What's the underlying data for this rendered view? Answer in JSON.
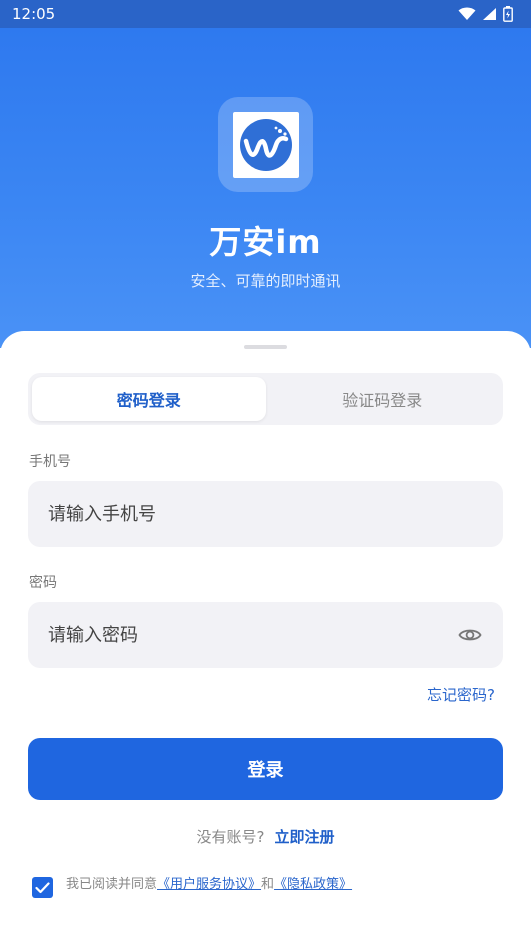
{
  "status_bar": {
    "time": "12:05",
    "icons": [
      "wifi-icon",
      "signal-icon",
      "battery-icon"
    ]
  },
  "app": {
    "title": "万安im",
    "subtitle": "安全、可靠的即时通讯",
    "icon": "app-logo-icon"
  },
  "tabs": [
    {
      "label": "密码登录",
      "active": true
    },
    {
      "label": "验证码登录",
      "active": false
    }
  ],
  "phone": {
    "label": "手机号",
    "placeholder": "请输入手机号",
    "value": ""
  },
  "password": {
    "label": "密码",
    "placeholder": "请输入密码",
    "value": "",
    "toggle_icon": "eye-icon"
  },
  "forgot_label": "忘记密码?",
  "login_label": "登录",
  "register": {
    "prompt": "没有账号?",
    "link": "立即注册"
  },
  "agreement": {
    "checked": true,
    "prefix": "我已阅读并同意",
    "service": "《用户服务协议》",
    "joiner": "和",
    "privacy": "《隐私政策》"
  },
  "colors": {
    "primary": "#1f66e0",
    "link": "#2a66cc",
    "hero_top": "#2e79ef",
    "input_bg": "#f2f2f6"
  }
}
